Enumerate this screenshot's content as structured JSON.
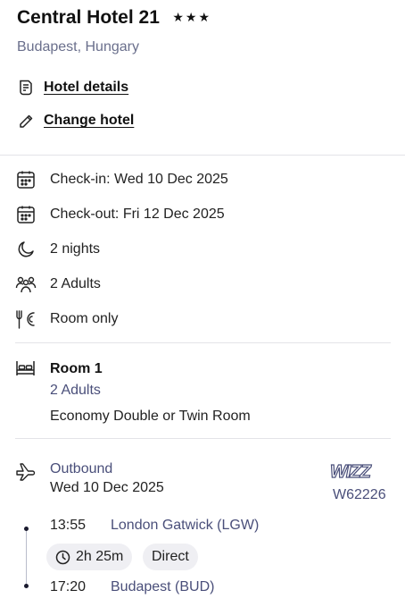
{
  "hotel": {
    "name": "Central Hotel 21",
    "stars": "★★★",
    "location": "Budapest, Hungary",
    "details_link": "Hotel details",
    "change_link": "Change hotel"
  },
  "stay": {
    "checkin": "Check-in: Wed 10 Dec 2025",
    "checkout": "Check-out: Fri 12 Dec 2025",
    "nights": "2 nights",
    "guests": "2 Adults",
    "board": "Room only"
  },
  "room": {
    "title": "Room 1",
    "adults": "2 Adults",
    "type": "Economy Double or Twin Room"
  },
  "flight": {
    "label": "Outbound",
    "date": "Wed 10 Dec 2025",
    "airline_logo_text": "WIZZ",
    "flight_number": "W62226",
    "departure_time": "13:55",
    "departure_airport": "London Gatwick (LGW)",
    "duration": "2h 25m",
    "stops": "Direct",
    "arrival_time": "17:20",
    "arrival_airport": "Budapest (BUD)"
  },
  "colors": {
    "primary_text": "#111111",
    "muted_text": "#4a4f7a",
    "location_text": "#6a6f8c",
    "chip_bg": "#efeff3",
    "divider": "#e3e3e8"
  }
}
